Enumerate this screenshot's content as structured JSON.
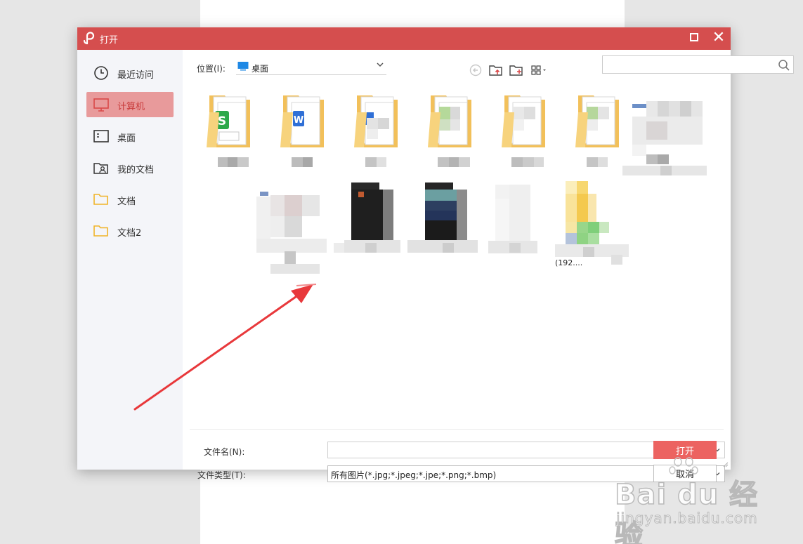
{
  "dialog": {
    "title": "打开"
  },
  "sidebar": {
    "items": [
      {
        "label": "最近访问",
        "icon": "clock-icon",
        "active": false
      },
      {
        "label": "计算机",
        "icon": "monitor-icon",
        "active": true
      },
      {
        "label": "桌面",
        "icon": "desktop-icon",
        "active": false
      },
      {
        "label": "我的文档",
        "icon": "user-folder-icon",
        "active": false
      },
      {
        "label": "文档",
        "icon": "folder-icon",
        "active": false
      },
      {
        "label": "文档2",
        "icon": "folder-icon",
        "active": false
      }
    ]
  },
  "toolbar": {
    "location_label": "位置(I):",
    "location_value": "桌面",
    "search_placeholder": ""
  },
  "footer": {
    "filename_label": "文件名(N):",
    "filename_value": "",
    "filetype_label": "文件类型(T):",
    "filetype_value": "所有图片(*.jpg;*.jpeg;*.jpe;*.png;*.bmp)",
    "open_button": "打开",
    "cancel_button": "取消"
  },
  "files": {
    "partial_caption": "(192...."
  },
  "watermark": {
    "brand": "Bai du 经验",
    "url": "jingyan.baidu.com"
  },
  "colors": {
    "titlebar": "#d54e4e",
    "accent": "#ec6361",
    "sidebar_active": "#e89a9b",
    "arrow": "#e8383b"
  }
}
